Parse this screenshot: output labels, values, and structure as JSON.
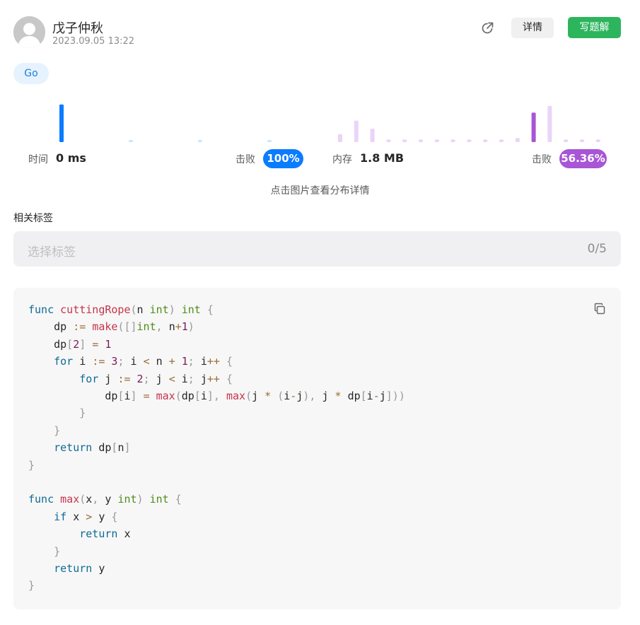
{
  "header": {
    "username": "戊子仲秋",
    "timestamp": "2023.09.05 13:22",
    "detail_label": "详情",
    "write_label": "写题解"
  },
  "language_tag": "Go",
  "stats": {
    "time_label": "时间",
    "time_value": "0 ms",
    "time_beat_label": "击败",
    "time_beat_value": "100%",
    "memory_label": "内存",
    "memory_value": "1.8 MB",
    "memory_beat_label": "击败",
    "memory_beat_value": "56.36%",
    "hint": "点击图片查看分布详情"
  },
  "runtime_distribution": {
    "color_selected": "#0a7cff",
    "color_other": "#cfe3fb",
    "selected_index": 0,
    "values": [
      28,
      1,
      1,
      1
    ]
  },
  "memory_distribution": {
    "color_selected": "#a855d6",
    "color_other": "#ead4f7",
    "selected_index": 12,
    "values": [
      6,
      16,
      10,
      2,
      2,
      2,
      2,
      2,
      2,
      2,
      2,
      3,
      22,
      27,
      2,
      2,
      2
    ]
  },
  "tags": {
    "heading": "相关标签",
    "placeholder": "选择标签",
    "count": "0/5"
  },
  "code": {
    "language": "go",
    "lines": [
      "func cuttingRope(n int) int {",
      "    dp := make([]int, n+1)",
      "    dp[2] = 1",
      "    for i := 3; i < n + 1; i++ {",
      "        for j := 2; j < i; j++ {",
      "            dp[i] = max(dp[i], max(j * (i-j), j * dp[i-j]))",
      "        }",
      "    }",
      "    return dp[n]",
      "}",
      "",
      "func max(x, y int) int {",
      "    if x > y {",
      "        return x",
      "    }",
      "    return y",
      "}"
    ]
  }
}
